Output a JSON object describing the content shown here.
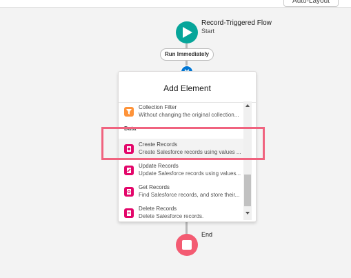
{
  "toolbar": {
    "auto_layout_label": "Auto-Layout"
  },
  "start": {
    "title": "Record-Triggered Flow",
    "subtitle": "Start"
  },
  "run_pill": "Run Immediately",
  "panel": {
    "title": "Add Element",
    "section_label": "Data",
    "items": [
      {
        "title": "Collection Filter",
        "desc": "Without changing the original collection...",
        "icon": "filter-icon",
        "color": "#fe9339"
      },
      {
        "title": "Create Records",
        "desc": "Create Salesforce records using values ...",
        "icon": "create-records-icon",
        "color": "#e3066a"
      },
      {
        "title": "Update Records",
        "desc": "Update Salesforce records using values...",
        "icon": "update-records-icon",
        "color": "#e3066a"
      },
      {
        "title": "Get Records",
        "desc": "Find Salesforce records, and store their...",
        "icon": "get-records-icon",
        "color": "#e3066a"
      },
      {
        "title": "Delete Records",
        "desc": "Delete Salesforce records.",
        "icon": "delete-records-icon",
        "color": "#e3066a"
      }
    ]
  },
  "end": {
    "label": "End"
  },
  "colors": {
    "start": "#06a59a",
    "end": "#f35b72",
    "highlight": "#f0637f",
    "add_button": "#0176d3"
  }
}
